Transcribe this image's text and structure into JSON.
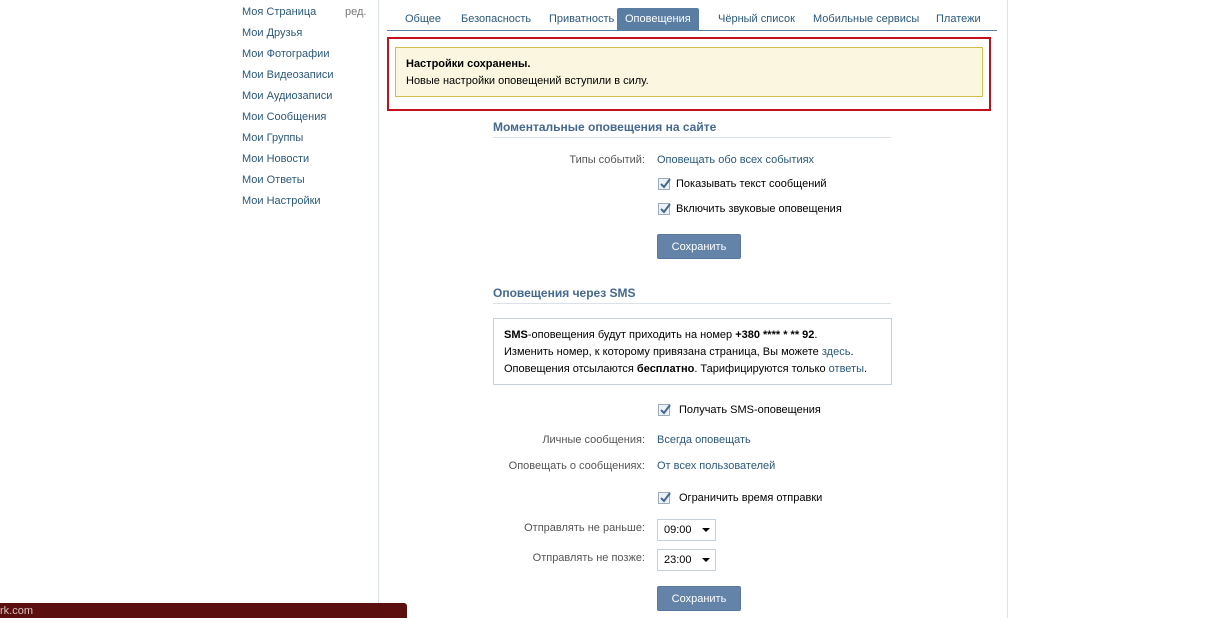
{
  "sidebar": {
    "items": [
      {
        "label": "Моя Страница"
      },
      {
        "label": "Мои Друзья"
      },
      {
        "label": "Мои Фотографии"
      },
      {
        "label": "Мои Видеозаписи"
      },
      {
        "label": "Мои Аудиозаписи"
      },
      {
        "label": "Мои Сообщения"
      },
      {
        "label": "Мои Группы"
      },
      {
        "label": "Мои Новости"
      },
      {
        "label": "Мои Ответы"
      },
      {
        "label": "Мои Настройки"
      }
    ],
    "edit_label": "ред."
  },
  "tabs": [
    {
      "label": "Общее"
    },
    {
      "label": "Безопасность"
    },
    {
      "label": "Приватность"
    },
    {
      "label": "Оповещения",
      "active": true
    },
    {
      "label": "Чёрный список"
    },
    {
      "label": "Мобильные сервисы"
    },
    {
      "label": "Платежи"
    }
  ],
  "notice": {
    "title": "Настройки сохранены.",
    "text": "Новые настройки оповещений вступили в силу."
  },
  "instant": {
    "title": "Моментальные оповещения на сайте",
    "event_types_label": "Типы событий:",
    "event_types_value": "Оповещать обо всех событиях",
    "show_text_label": "Показывать текст сообщений",
    "show_text_checked": true,
    "sound_label": "Включить звуковые оповещения",
    "sound_checked": true,
    "save_label": "Сохранить"
  },
  "sms": {
    "title": "Оповещения через SMS",
    "info_line1_bold": "SMS",
    "info_line1_text": "-оповещения будут приходить на номер ",
    "info_line1_number": "+380 **** * ** 92",
    "info_line1_end": ".",
    "info_line2_text": "Изменить номер, к которому привязана страница, Вы можете ",
    "info_line2_link": "здесь",
    "info_line2_end": ".",
    "info_line3_text": "Оповещения отсылаются ",
    "info_line3_bold": "бесплатно",
    "info_line3_mid": ". Тарифицируются только ",
    "info_line3_link": "ответы",
    "info_line3_end": ".",
    "receive_label": "Получать SMS-оповещения",
    "receive_checked": true,
    "personal_label": "Личные сообщения:",
    "personal_value": "Всегда оповещать",
    "notify_from_label": "Оповещать о сообщениях:",
    "notify_from_value": "От всех пользователей",
    "limit_time_label": "Ограничить время отправки",
    "limit_time_checked": true,
    "not_earlier_label": "Отправлять не раньше:",
    "not_earlier_value": "09:00",
    "not_later_label": "Отправлять не позже:",
    "not_later_value": "23:00",
    "save_label": "Сохранить"
  },
  "footer": {
    "text": "rk.com"
  },
  "colors": {
    "link": "#2b587a",
    "tab_active": "#597da3",
    "button": "#6383a8",
    "notice_bg": "#faf6e0",
    "highlight_frame": "#c4101a",
    "footer_bar": "#5c0f0f"
  }
}
